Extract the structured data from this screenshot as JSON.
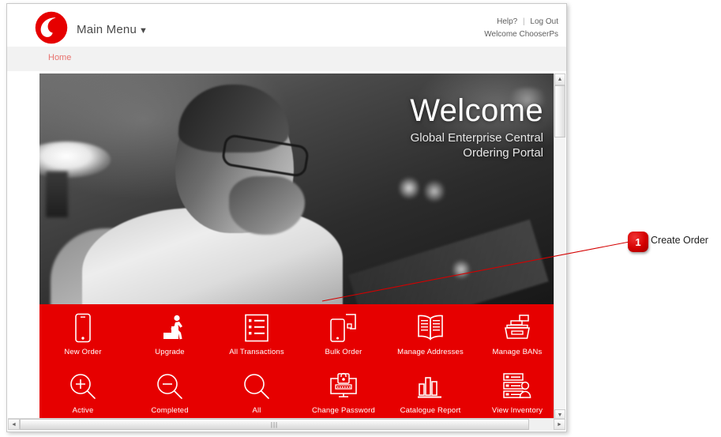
{
  "header": {
    "logo_icon": "vodafone-logo-icon",
    "main_menu_label": "Main Menu",
    "main_menu_caret": "▼",
    "help_label": "Help?",
    "separator": "|",
    "logout_label": "Log Out",
    "welcome_text": "Welcome ChooserPs"
  },
  "breadcrumb": {
    "home_label": "Home"
  },
  "hero": {
    "title": "Welcome",
    "subtitle": "Global Enterprise Central Ordering Portal"
  },
  "tiles": {
    "row1": [
      {
        "label": "New Order",
        "icon": "smartphone-icon"
      },
      {
        "label": "Upgrade",
        "icon": "person-stairs-icon"
      },
      {
        "label": "All Transactions",
        "icon": "list-document-icon"
      },
      {
        "label": "Bulk Order",
        "icon": "two-devices-icon"
      },
      {
        "label": "Manage Addresses",
        "icon": "open-book-icon"
      },
      {
        "label": "Manage BANs",
        "icon": "printer-icon"
      }
    ],
    "row2": [
      {
        "label": "Active",
        "icon": "magnifier-plus-icon"
      },
      {
        "label": "Completed",
        "icon": "magnifier-minus-icon"
      },
      {
        "label": "All",
        "icon": "magnifier-icon"
      },
      {
        "label": "Change Password",
        "icon": "monitor-lock-icon"
      },
      {
        "label": "Catalogue Report",
        "icon": "bar-chart-icon"
      },
      {
        "label": "View Inventory",
        "icon": "servers-user-icon"
      }
    ]
  },
  "scrollbars": {
    "up_arrow": "▲",
    "down_arrow": "▼",
    "left_arrow": "◄",
    "right_arrow": "►",
    "grip": "|||"
  },
  "annotation": {
    "number": "1",
    "label": "Create Order"
  },
  "colors": {
    "vodafone_red": "#E60000",
    "callout_red": "#D40000",
    "breadcrumb_link": "#E8736F"
  }
}
